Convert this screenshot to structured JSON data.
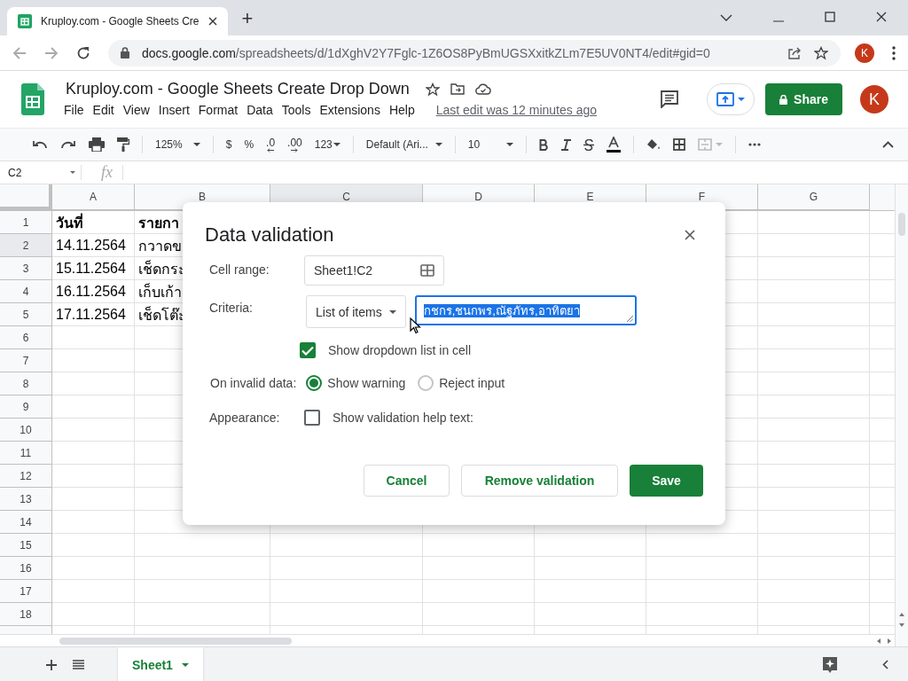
{
  "browser": {
    "tab_title": "Kruploy.com - Google Sheets Cre",
    "new_tab": "+",
    "url_domain": "docs.google.com",
    "url_path": "/spreadsheets/d/1dXghV2Y7Fglc-1Z6OS8PyBmUGSXxitkZLm7E5UV0NT4/edit#gid=0",
    "profile_initial": "K"
  },
  "doc": {
    "title": "Kruploy.com - Google Sheets Create Drop Down",
    "menu": [
      "File",
      "Edit",
      "View",
      "Insert",
      "Format",
      "Data",
      "Tools",
      "Extensions",
      "Help"
    ],
    "last_edit": "Last edit was 12 minutes ago",
    "share": "Share",
    "avatar": "K"
  },
  "toolbar": {
    "zoom": "125%",
    "currency": "$",
    "percent": "%",
    "dec_less": ".0",
    "dec_more": ".00",
    "number_format": "123",
    "font": "Default (Ari...",
    "font_size": "10"
  },
  "formula_bar": {
    "name_box": "C2",
    "fx": "fx"
  },
  "sheet": {
    "columns": [
      {
        "label": "A",
        "selected": false
      },
      {
        "label": "B",
        "selected": false
      },
      {
        "label": "C",
        "selected": true
      },
      {
        "label": "D",
        "selected": false
      },
      {
        "label": "E",
        "selected": false
      },
      {
        "label": "F",
        "selected": false
      },
      {
        "label": "G",
        "selected": false
      }
    ],
    "rows": [
      {
        "label": "1",
        "selected": false,
        "cells": [
          "วันที่",
          "รายกา"
        ]
      },
      {
        "label": "2",
        "selected": true,
        "cells": [
          "14.11.2564",
          "กวาดข"
        ]
      },
      {
        "label": "3",
        "selected": false,
        "cells": [
          "15.11.2564",
          "เช็ดกระ"
        ]
      },
      {
        "label": "4",
        "selected": false,
        "cells": [
          "16.11.2564",
          "เก็บเก้า"
        ]
      },
      {
        "label": "5",
        "selected": false,
        "cells": [
          "17.11.2564",
          "เช็ดโต๊ะ"
        ]
      },
      {
        "label": "6",
        "selected": false,
        "cells": []
      },
      {
        "label": "7",
        "selected": false,
        "cells": []
      },
      {
        "label": "8",
        "selected": false,
        "cells": []
      },
      {
        "label": "9",
        "selected": false,
        "cells": []
      },
      {
        "label": "10",
        "selected": false,
        "cells": []
      },
      {
        "label": "11",
        "selected": false,
        "cells": []
      },
      {
        "label": "12",
        "selected": false,
        "cells": []
      },
      {
        "label": "13",
        "selected": false,
        "cells": []
      },
      {
        "label": "14",
        "selected": false,
        "cells": []
      },
      {
        "label": "15",
        "selected": false,
        "cells": []
      },
      {
        "label": "16",
        "selected": false,
        "cells": []
      },
      {
        "label": "17",
        "selected": false,
        "cells": []
      },
      {
        "label": "18",
        "selected": false,
        "cells": []
      }
    ]
  },
  "dialog": {
    "title": "Data validation",
    "cell_range_label": "Cell range:",
    "cell_range": "Sheet1!C2",
    "criteria_label": "Criteria:",
    "criteria": "List of items",
    "items": "กชกร,ชนกพร,ณัฐภัทร,อาทิตยา",
    "items_selected": true,
    "show_dropdown": {
      "label": "Show dropdown list in cell",
      "checked": true
    },
    "invalid_label": "On invalid data:",
    "invalid_options": [
      {
        "label": "Show warning",
        "selected": true
      },
      {
        "label": "Reject input",
        "selected": false
      }
    ],
    "appearance_label": "Appearance:",
    "help_text": {
      "label": "Show validation help text:",
      "checked": false
    },
    "buttons": [
      {
        "label": "Cancel",
        "kind": "secondary"
      },
      {
        "label": "Remove validation",
        "kind": "secondary"
      },
      {
        "label": "Save",
        "kind": "primary"
      }
    ]
  },
  "sheet_tabs": [
    {
      "label": "Sheet1",
      "selected": true
    }
  ]
}
